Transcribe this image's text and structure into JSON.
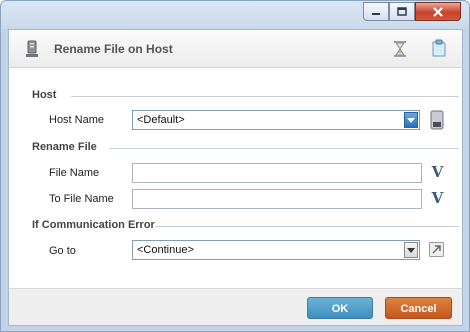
{
  "window": {
    "controls": {
      "minimize_icon": "minimize-icon",
      "maximize_icon": "maximize-icon",
      "close_icon": "close-icon"
    }
  },
  "header": {
    "title": "Rename File on Host",
    "icons": [
      "host-computer-icon",
      "hourglass-icon",
      "note-icon"
    ]
  },
  "sections": {
    "host": {
      "title": "Host",
      "host_name_label": "Host Name",
      "host_name_value": "<Default>"
    },
    "rename_file": {
      "title": "Rename File",
      "file_name_label": "File Name",
      "file_name_value": "",
      "to_file_name_label": "To File Name",
      "to_file_name_value": "",
      "variable_button_glyph": "V"
    },
    "error": {
      "title": "If Communication Error",
      "goto_label": "Go to",
      "goto_value": "<Continue>"
    }
  },
  "footer": {
    "ok_label": "OK",
    "cancel_label": "Cancel"
  },
  "colors": {
    "ok_button": "#4f9dc8",
    "cancel_button": "#d2692c",
    "dropdown_arrow_active": "#2a6fc0"
  }
}
